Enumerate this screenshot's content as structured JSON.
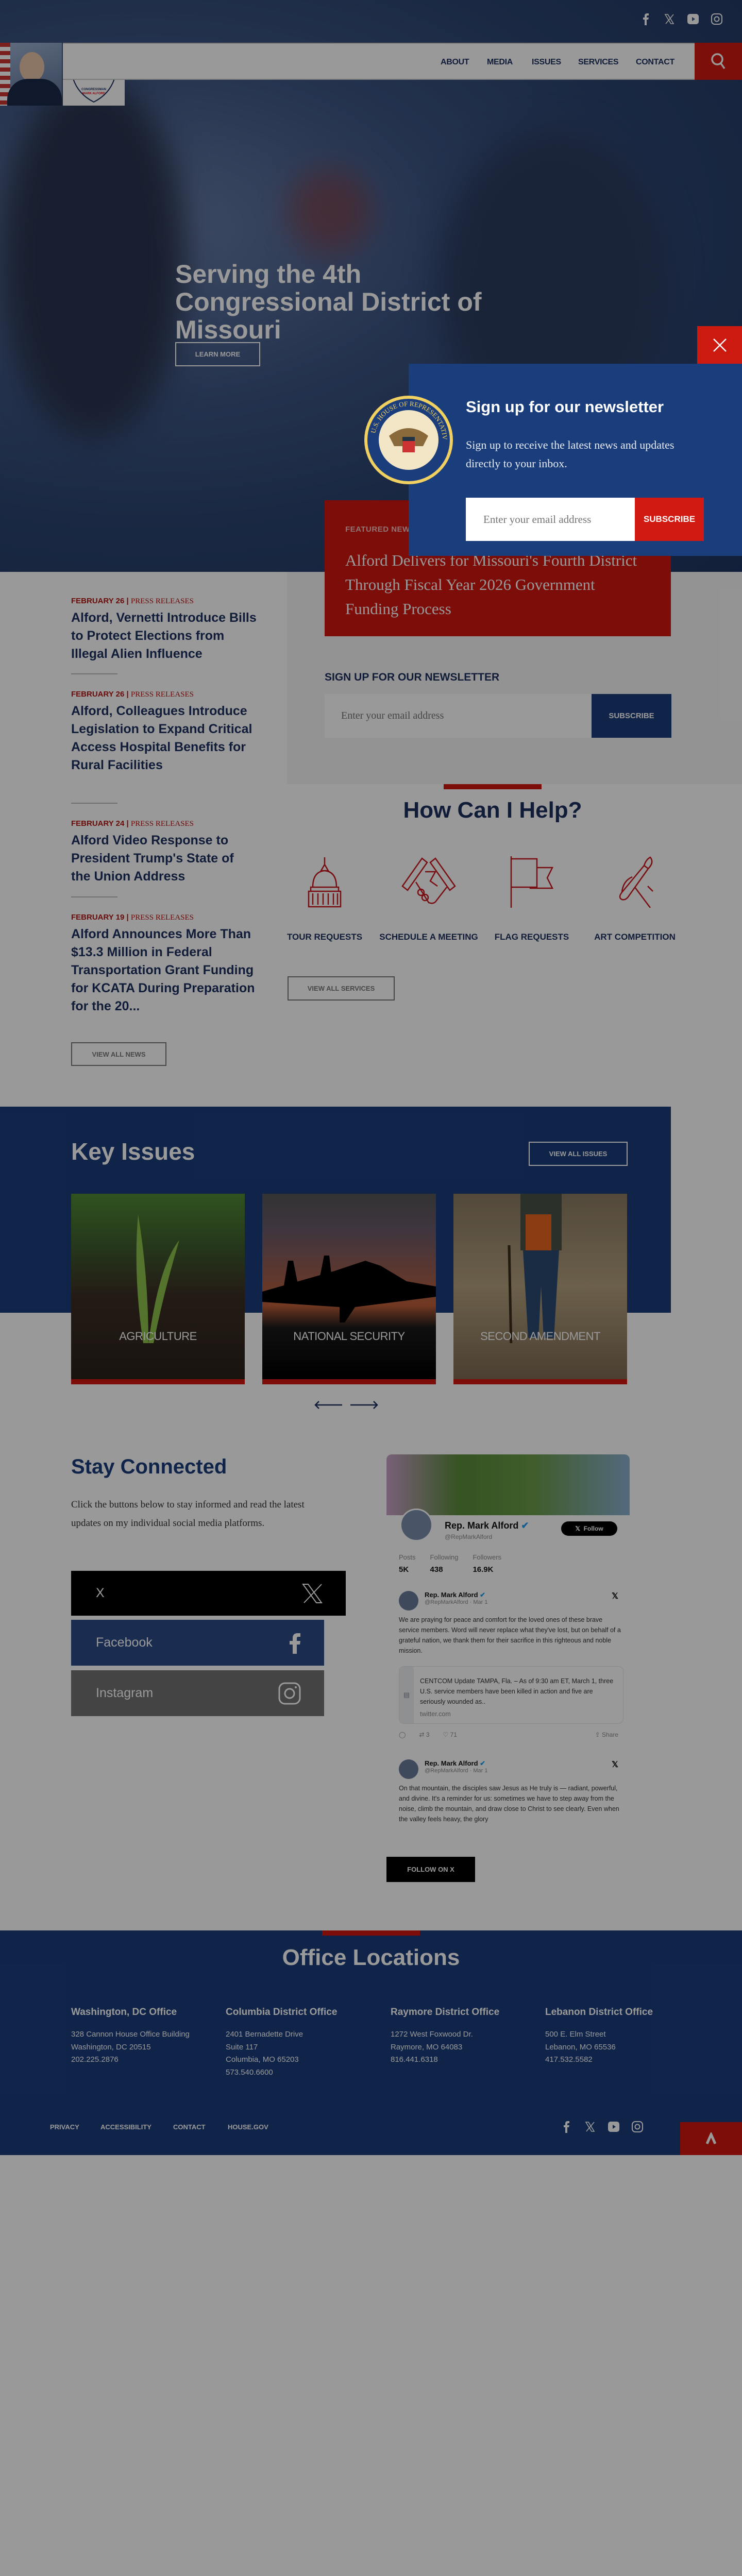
{
  "header": {
    "social": [
      "facebook-icon",
      "x-icon",
      "youtube-icon",
      "instagram-icon"
    ],
    "logo_text": [
      "CONGRESSMAN",
      "MARK ALFORD"
    ],
    "nav": [
      {
        "label": "ABOUT"
      },
      {
        "label": "MEDIA"
      },
      {
        "label": "ISSUES"
      },
      {
        "label": "SERVICES"
      },
      {
        "label": "CONTACT"
      }
    ]
  },
  "hero": {
    "title": "Serving the 4th Congressional District of Missouri",
    "cta": "LEARN MORE"
  },
  "featured": {
    "label": "FEATURED NEWS",
    "title": "Alford Delivers for Missouri's Fourth District Through Fiscal Year 2026 Government Funding Process"
  },
  "news": [
    {
      "date": "FEBRUARY 26",
      "category": "PRESS RELEASES",
      "title": "Alford, Vernetti Introduce Bills to Protect Elections from Illegal Alien Influence"
    },
    {
      "date": "FEBRUARY 26",
      "category": "PRESS RELEASES",
      "title": "Alford, Colleagues Introduce Legislation to Expand Critical Access Hospital Benefits for Rural Facilities"
    },
    {
      "date": "FEBRUARY 24",
      "category": "PRESS RELEASES",
      "title": "Alford Video Response to President Trump's State of the Union Address"
    },
    {
      "date": "FEBRUARY 19",
      "category": "PRESS RELEASES",
      "title": "Alford Announces More Than $13.3 Million in Federal Transportation Grant Funding for KCATA During Preparation for the 20..."
    }
  ],
  "news_button": "VIEW ALL NEWS",
  "newsletter_section": {
    "title": "SIGN UP FOR OUR NEWSLETTER",
    "placeholder": "Enter your email address",
    "button": "SUBSCRIBE"
  },
  "help": {
    "title": "How Can I Help?",
    "items": [
      {
        "label": "TOUR REQUESTS",
        "icon": "capitol-icon"
      },
      {
        "label": "SCHEDULE A MEETING",
        "icon": "handshake-icon"
      },
      {
        "label": "FLAG REQUESTS",
        "icon": "flag-icon"
      },
      {
        "label": "ART COMPETITION",
        "icon": "paintbrush-icon"
      }
    ],
    "button": "VIEW ALL SERVICES"
  },
  "issues": {
    "title": "Key Issues",
    "button": "VIEW ALL ISSUES",
    "cards": [
      "AGRICULTURE",
      "NATIONAL SECURITY",
      "SECOND AMENDMENT"
    ]
  },
  "connect": {
    "title": "Stay Connected",
    "text": "Click the buttons below to stay informed and read the latest updates on my individual social media platforms.",
    "buttons": [
      {
        "label": "X",
        "color": "#000000"
      },
      {
        "label": "Facebook",
        "color": "#2c4a85"
      },
      {
        "label": "Instagram",
        "color": "#727272"
      }
    ]
  },
  "twitter": {
    "name": "Rep. Mark Alford",
    "handle": "@RepMarkAlford",
    "follow": "Follow",
    "stats": [
      {
        "label": "Posts",
        "value": "5K"
      },
      {
        "label": "Following",
        "value": "438"
      },
      {
        "label": "Followers",
        "value": "16.9K"
      }
    ],
    "tweets": [
      {
        "date": "· Mar 1",
        "text": "We are praying for peace and comfort for the loved ones of these brave service members. Word will never replace what they've lost, but on behalf of a grateful nation, we thank them for their sacrifice in this righteous and noble mission.",
        "card_text": "CENTCOM Update TAMPA, Fla. – As of 9:30 am ET, March 1, three U.S. service members have been killed in action and five are seriously wounded as..",
        "card_domain": "twitter.com",
        "retweets": "3",
        "likes": "71",
        "share": "Share"
      },
      {
        "date": "· Mar 1",
        "text": "On that mountain, the disciples saw Jesus as He truly is — radiant, powerful, and divine. It's a reminder for us: sometimes we have to step away from the noise, climb the mountain, and draw close to Christ to see clearly. Even when the valley feels heavy, the glory"
      }
    ],
    "follow_button": "FOLLOW ON X"
  },
  "offices": {
    "title": "Office Locations",
    "list": [
      {
        "name": "Washington, DC Office",
        "lines": [
          "328 Cannon House Office Building",
          "Washington, DC 20515",
          "202.225.2876"
        ]
      },
      {
        "name": "Columbia District Office",
        "lines": [
          "2401 Bernadette Drive",
          "Suite 117",
          "Columbia, MO 65203",
          "573.540.6600"
        ]
      },
      {
        "name": "Raymore District Office",
        "lines": [
          "1272 West Foxwood Dr.",
          "Raymore, MO 64083",
          "816.441.6318"
        ]
      },
      {
        "name": "Lebanon District Office",
        "lines": [
          "500 E. Elm Street",
          "Lebanon, MO 65536",
          "417.532.5582"
        ]
      }
    ]
  },
  "footer": {
    "links": [
      "PRIVACY",
      "ACCESSIBILITY",
      "CONTACT",
      "HOUSE.GOV"
    ]
  },
  "popup": {
    "title": "Sign up for our newsletter",
    "text": "Sign up to receive the latest news and updates directly to your inbox.",
    "placeholder": "Enter your email address",
    "button": "SUBSCRIBE",
    "seal_text": "U.S. HOUSE OF REPRESENTATIVES"
  },
  "colors": {
    "navy": "#1b3d7b",
    "red": "#d0160f",
    "text_navy": "#1b2f5e"
  }
}
